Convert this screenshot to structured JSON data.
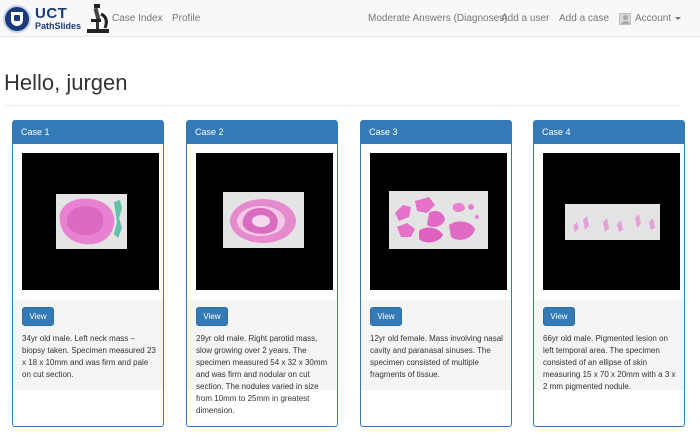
{
  "brand": {
    "title": "UCT",
    "subtitle": "PathSlides"
  },
  "nav": {
    "left": [
      "Case Index",
      "Profile"
    ],
    "right": [
      "Moderate Answers (Diagnoses)",
      "Add a user",
      "Add a case"
    ],
    "account_label": "Account"
  },
  "greeting": "Hello, jurgen",
  "cases": [
    {
      "title": "Case 1",
      "view_label": "View",
      "description": "34yr old male. Left neck mass – biopsy taken. Specimen measured 23 x 18 x 10mm and was firm and pale on cut section."
    },
    {
      "title": "Case 2",
      "view_label": "View",
      "description": "29yr old male. Right parotid mass, slow growing over 2 years. The specimen measured 54 x 32 x 30mm and was firm and nodular on cut section. The nodules varied in size from 10mm to 25mm in greatest dimension."
    },
    {
      "title": "Case 3",
      "view_label": "View",
      "description": "12yr old female. Mass involving nasal cavity and paranasal sinuses. The specimen consisted of multiple fragments of tissue."
    },
    {
      "title": "Case 4",
      "view_label": "View",
      "description": "66yr old male. Pigmented lesion on left temporal area. The specimen consisted of an ellipse of skin measuring 15 x 70 x 20mm with a 3 x 2 mm pigmented nodule."
    }
  ],
  "colors": {
    "primary": "#337ab7",
    "navbar_bg": "#f8f8f8",
    "thumbnail_bg": "#000000",
    "tissue_stain": "#e66fc6"
  }
}
